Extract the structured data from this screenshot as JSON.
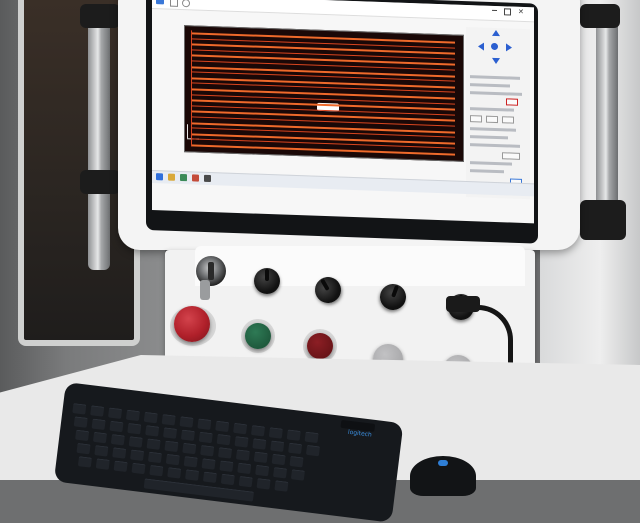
{
  "scene": {
    "description_tags": [
      "machine-control-console",
      "monitor",
      "keyboard"
    ]
  },
  "screen": {
    "taskbar_time": "",
    "panel_heading": ""
  },
  "console": {
    "knob_labels": [
      "",
      "",
      "",
      ""
    ],
    "button_labels": {
      "green": "",
      "red": "",
      "grey_left": "",
      "grey_right": "",
      "switch": ""
    }
  },
  "keyboard": {
    "brand": "logitech"
  },
  "colors": {
    "trace_red": "#d8451f",
    "canvas_bg": "#1a0807",
    "estop_red": "#b0202a",
    "start_green": "#1f5a3d",
    "stop_red": "#6a1418",
    "grey_button": "#a9a9ab",
    "key_legend_blue": "#2e7bd1"
  }
}
